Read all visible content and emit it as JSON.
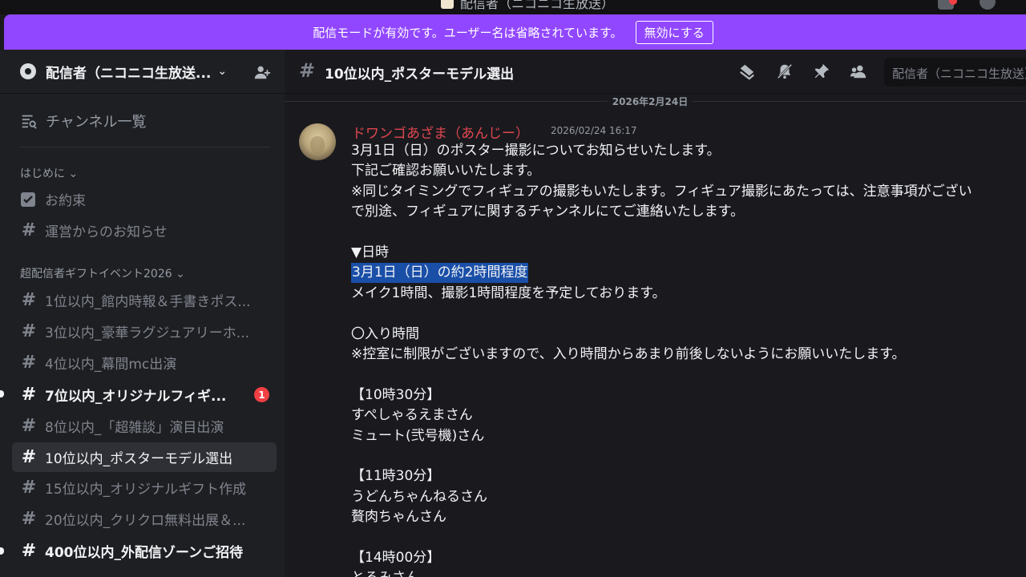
{
  "window": {
    "title": "配信者（ニコニコ生放送）"
  },
  "banner": {
    "text": "配信モードが有効です。ユーザー名は省略されています。",
    "button": "無効にする"
  },
  "server": {
    "name": "配信者（ニコニコ生放送..."
  },
  "sidebar": {
    "browse": "チャンネル一覧",
    "categories": [
      {
        "name": "はじめに",
        "chevron": "⌄"
      },
      {
        "name": "超配信者ギフトイベント2026",
        "chevron": "⌄"
      }
    ],
    "intro_channels": [
      {
        "label": "お約束",
        "icon": "rules-icon"
      },
      {
        "label": "運営からのお知らせ",
        "icon": "hash-icon"
      }
    ],
    "event_channels": [
      {
        "label": "1位以内_館内時報＆手書きポス..."
      },
      {
        "label": "3位以内_豪華ラグジュアリーホ..."
      },
      {
        "label": "4位以内_幕間mc出演"
      },
      {
        "label": "7位以内_オリジナルフィギ...",
        "unread": true,
        "badge": "1"
      },
      {
        "label": "8位以内_「超雑談」演目出演"
      },
      {
        "label": "10位以内_ポスターモデル選出",
        "active": true
      },
      {
        "label": "15位以内_オリジナルギフト作成"
      },
      {
        "label": "20位以内_クリクロ無料出展＆..."
      },
      {
        "label": "400位以内_外配信ゾーンご招待",
        "unread": true
      }
    ]
  },
  "channel": {
    "name": "10位以内_ポスターモデル選出",
    "search_placeholder": "配信者（ニコニコ生放送）"
  },
  "date_separator": "2026年2月24日",
  "message": {
    "author": "ドワンゴあざま（あんじー）",
    "timestamp": "2026/02/24 16:17",
    "lines": [
      "3月1日（日）のポスター撮影についてお知らせいたします。",
      "下記ご確認お願いいたします。",
      "※同じタイミングでフィギュアの撮影もいたします。フィギュア撮影にあたっては、注意事項がござい",
      "で別途、フィギュアに関するチャンネルにてご連絡いたします。",
      "",
      "▼日時",
      "3月1日（日）の約2時間程度",
      "メイク1時間、撮影1時間程度を予定しております。",
      "",
      "〇入り時間",
      "※控室に制限がございますので、入り時間からあまり前後しないようにお願いいたします。",
      "",
      "【10時30分】",
      "すぺしゃるえまさん",
      "ミュート(弐号機)さん",
      "",
      "【11時30分】",
      "うどんちゃんねるさん",
      "贅肉ちゃんさん",
      "",
      "【14時00分】",
      "とろみさん"
    ],
    "highlighted_line_index": 6
  },
  "colors": {
    "banner": "#9147ff",
    "author": "#e0464f",
    "highlight": "#1a4fa8",
    "badge": "#f23f43"
  }
}
